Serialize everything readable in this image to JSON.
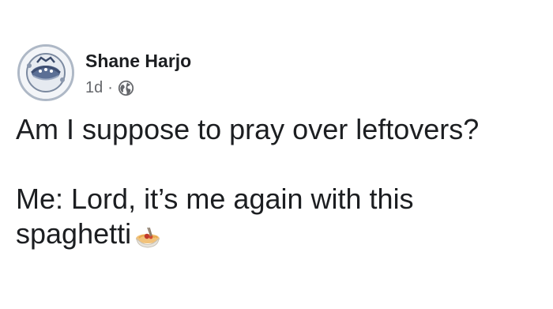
{
  "post": {
    "author": {
      "name": "Shane Harjo",
      "avatar_icon": "profile-avatar"
    },
    "meta": {
      "time": "1d",
      "separator": "·",
      "audience_icon": "globe-icon"
    },
    "text": {
      "line1": "Am I suppose to pray over leftovers?",
      "line2": "Me: Lord, it’s me again with this",
      "line3": "spaghetti",
      "emoji": "spaghetti-emoji"
    }
  },
  "colors": {
    "text": "#1c1e21",
    "secondary": "#65676b",
    "avatar_ring": "#aeb8c6"
  }
}
